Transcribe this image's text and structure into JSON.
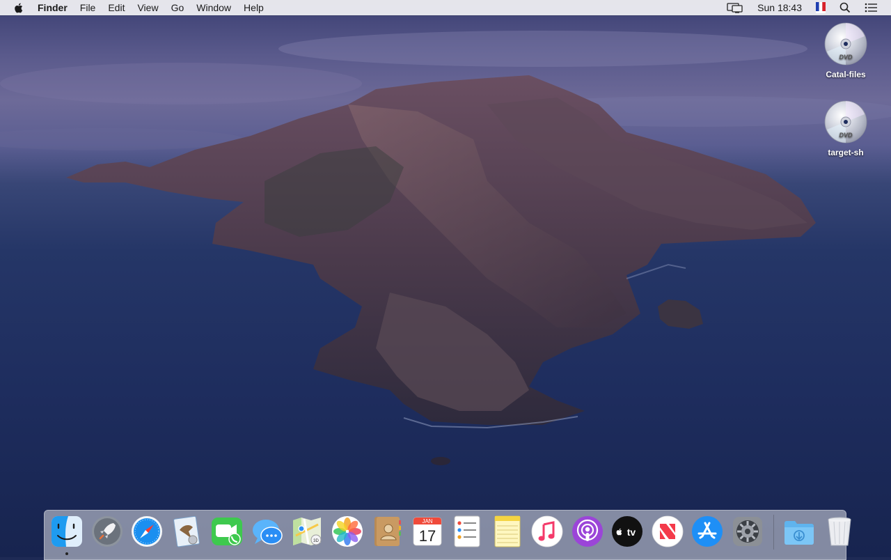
{
  "menubar": {
    "app_name": "Finder",
    "menus": [
      "File",
      "Edit",
      "View",
      "Go",
      "Window",
      "Help"
    ],
    "clock": "Sun 18:43",
    "status_icons": [
      "display-icon",
      "french-flag-input-icon",
      "spotlight-search-icon",
      "notification-center-icon"
    ]
  },
  "desktop": {
    "icons": [
      {
        "label": "Catal-files",
        "icon": "dvd-disc-icon"
      },
      {
        "label": "target-sh",
        "icon": "dvd-disc-icon"
      }
    ]
  },
  "dock": {
    "apps": [
      {
        "icon": "finder-icon",
        "running": true
      },
      {
        "icon": "launchpad-icon"
      },
      {
        "icon": "safari-icon"
      },
      {
        "icon": "mail-icon"
      },
      {
        "icon": "facetime-icon"
      },
      {
        "icon": "messages-icon"
      },
      {
        "icon": "maps-icon"
      },
      {
        "icon": "photos-icon"
      },
      {
        "icon": "contacts-icon"
      },
      {
        "icon": "calendar-icon",
        "month": "JAN",
        "day": "17"
      },
      {
        "icon": "reminders-icon"
      },
      {
        "icon": "notes-icon"
      },
      {
        "icon": "music-icon"
      },
      {
        "icon": "podcasts-icon"
      },
      {
        "icon": "apple-tv-icon",
        "label": "tv"
      },
      {
        "icon": "news-icon"
      },
      {
        "icon": "app-store-icon"
      },
      {
        "icon": "system-preferences-icon"
      }
    ],
    "others": [
      {
        "icon": "downloads-folder-icon"
      },
      {
        "icon": "trash-icon"
      }
    ]
  },
  "colors": {
    "menubar_bg": "#ececf0",
    "sky_top": "#3b3f72",
    "sea": "#1e2d5e",
    "island": "#4a3c4e"
  }
}
